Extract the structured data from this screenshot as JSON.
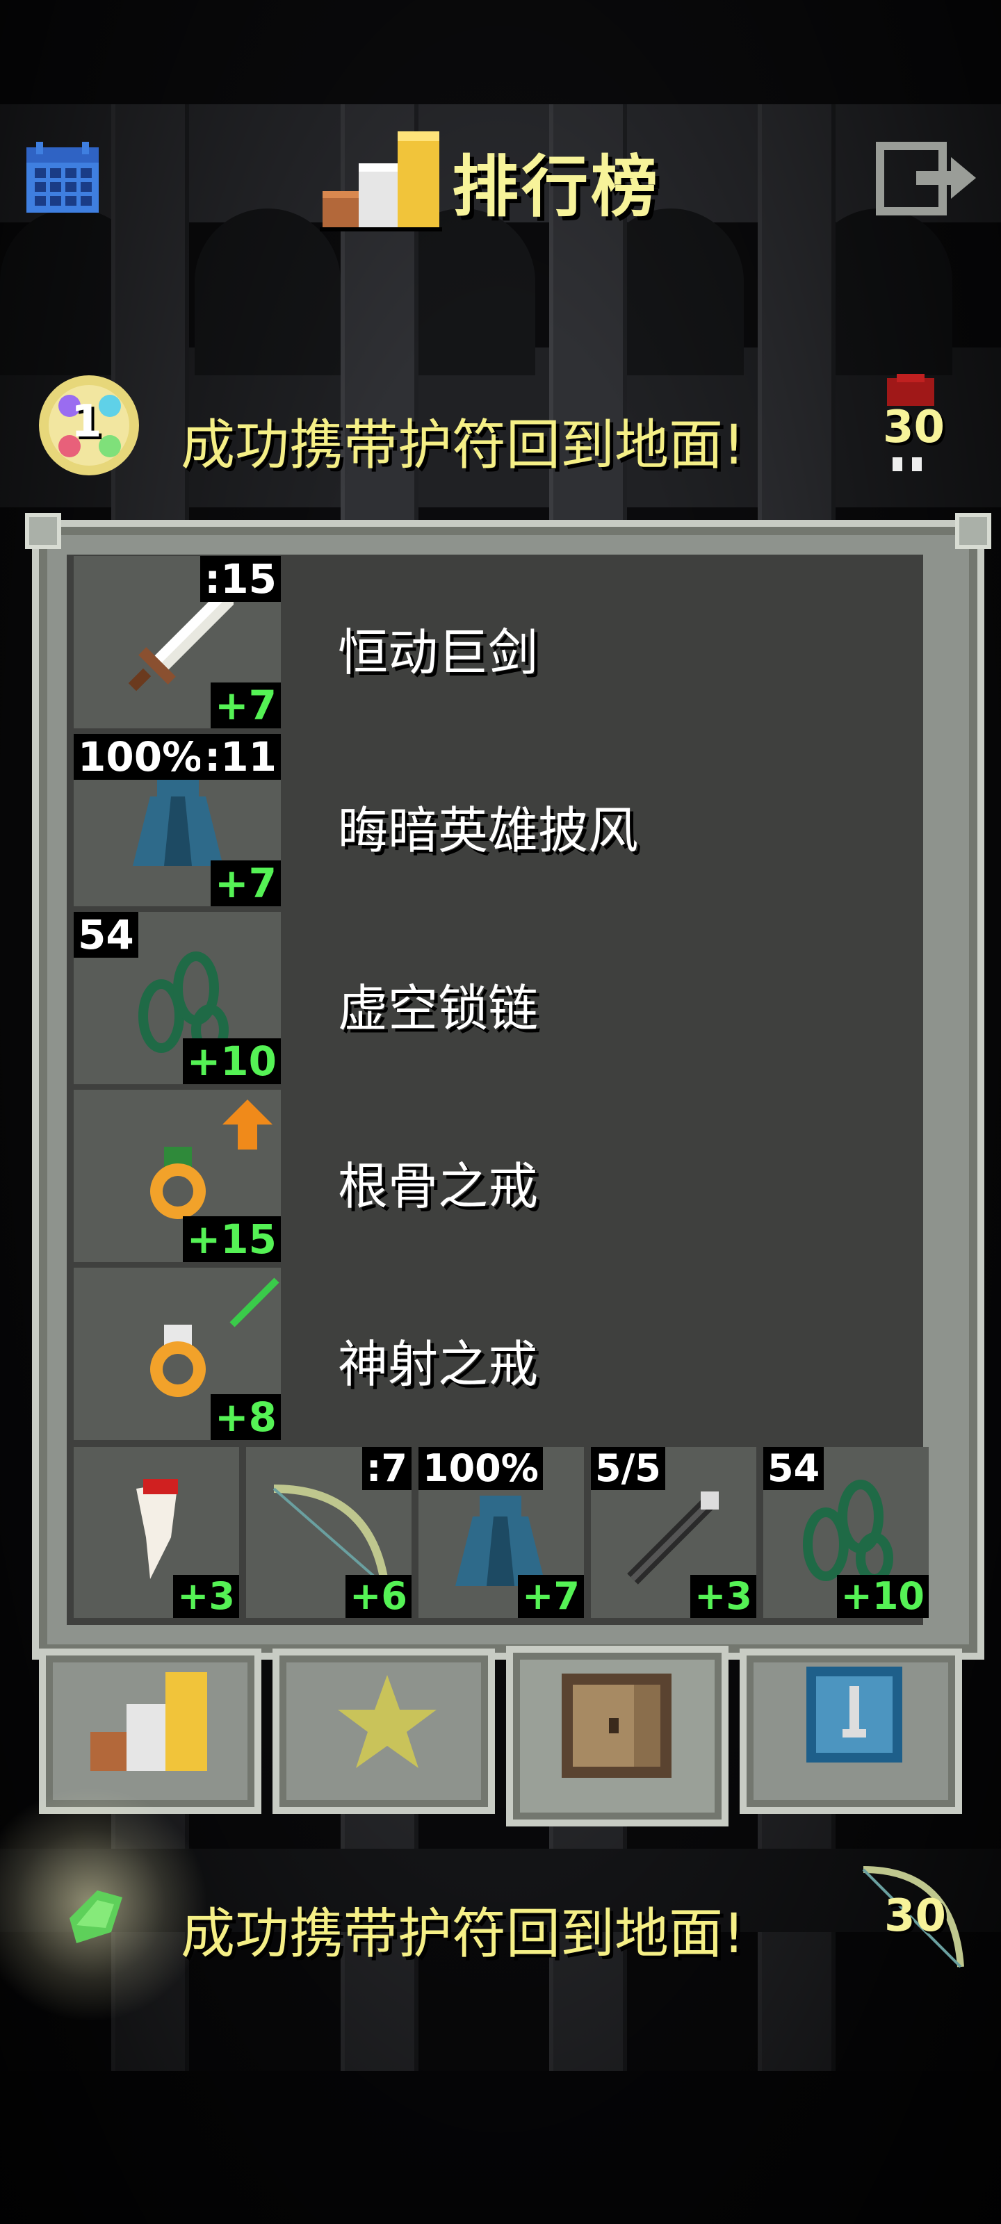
{
  "header": {
    "title": "排行榜"
  },
  "notices": {
    "top": {
      "text": "成功携带护符回到地面!",
      "badge": "1",
      "depth": "30"
    },
    "bottom": {
      "text": "成功携带护符回到地面!",
      "depth": "30"
    }
  },
  "items": [
    {
      "name": "恒动巨剑",
      "top_right": ":15",
      "top_left": "",
      "upgrade": "+7",
      "icon": "sword-icon"
    },
    {
      "name": "晦暗英雄披风",
      "top_right": ":11",
      "top_left": "100%",
      "upgrade": "+7",
      "icon": "cloak-icon"
    },
    {
      "name": "虚空锁链",
      "top_right": "",
      "top_left": "54",
      "upgrade": "+10",
      "icon": "chain-icon"
    },
    {
      "name": "根骨之戒",
      "top_right": "",
      "top_left": "",
      "upgrade": "+15",
      "icon": "ring-icon"
    },
    {
      "name": "神射之戒",
      "top_right": "",
      "top_left": "",
      "upgrade": "+8",
      "icon": "ring-icon"
    }
  ],
  "quickslots": [
    {
      "icon": "fang-icon",
      "top_left": "",
      "top_right": "",
      "upgrade": "+3"
    },
    {
      "icon": "bow-icon",
      "top_left": "",
      "top_right": ":7",
      "upgrade": "+6"
    },
    {
      "icon": "cloak-icon",
      "top_left": "100%",
      "top_right": "",
      "upgrade": "+7"
    },
    {
      "icon": "wand-icon",
      "top_left": "5/5",
      "top_right": "",
      "upgrade": "+3"
    },
    {
      "icon": "chain-icon",
      "top_left": "54",
      "top_right": "",
      "upgrade": "+10"
    }
  ],
  "tabs": [
    {
      "icon": "rankings-icon",
      "active": false
    },
    {
      "icon": "badges-icon",
      "active": false
    },
    {
      "icon": "items-icon",
      "active": true
    },
    {
      "icon": "journal-icon",
      "active": false
    }
  ],
  "colors": {
    "title": "#f7f39a",
    "notice": "#f5ef86",
    "upgrade": "#55f255"
  }
}
